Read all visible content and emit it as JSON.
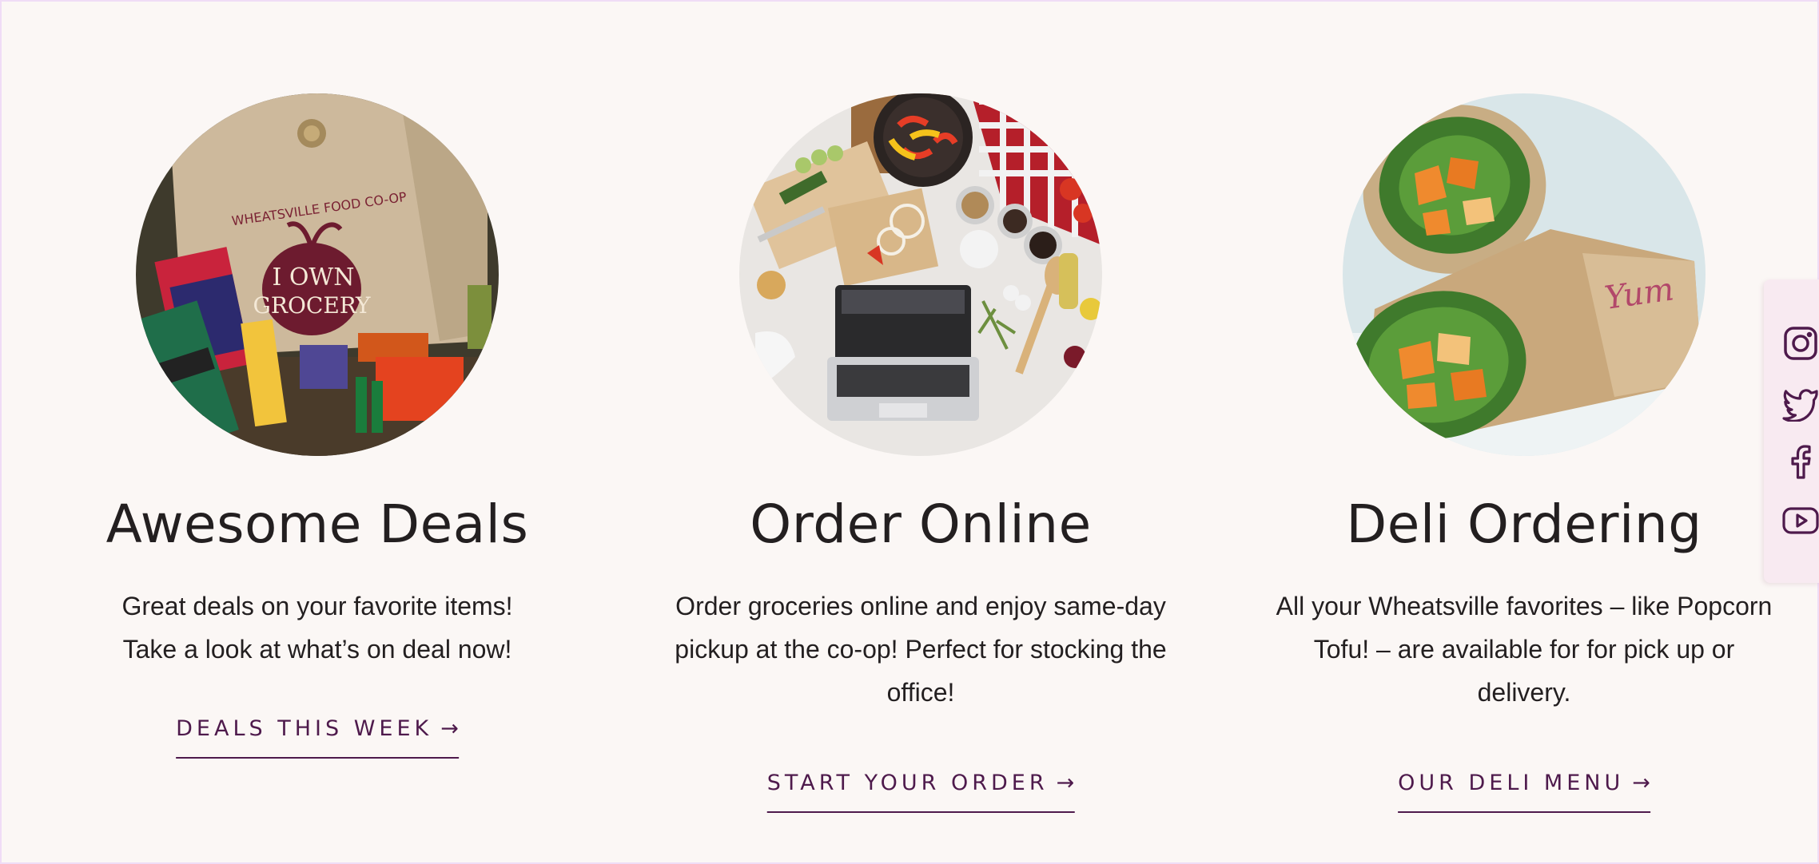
{
  "cards": [
    {
      "title": "Awesome Deals",
      "text_lines": [
        "Great deals on your favorite items!",
        "Take a look at what’s on deal now!"
      ],
      "cta": "DEALS THIS WEEK",
      "arrow": "→",
      "image_icon": "grocery-tote-photo"
    },
    {
      "title": "Order Online",
      "text_lines": [
        "Order groceries online and enjoy same-day",
        "pickup at the co-op! Perfect for stocking the",
        "office!"
      ],
      "cta": "START YOUR ORDER",
      "arrow": "→",
      "image_icon": "laptop-kitchen-photo"
    },
    {
      "title": "Deli Ordering",
      "text_lines": [
        "All your Wheatsville favorites – like Popcorn",
        "Tofu! – are available for for pick up or",
        "delivery."
      ],
      "cta": "OUR DELI MENU",
      "arrow": "→",
      "image_icon": "deli-wrap-photo"
    }
  ],
  "photo_text": {
    "tote_top": "WHEATSVILLE FOOD CO-OP",
    "tote_line1": "I OWN",
    "tote_line2": "GROCERY"
  },
  "social": {
    "icons": [
      "instagram-icon",
      "twitter-icon",
      "facebook-icon",
      "youtube-icon"
    ]
  },
  "colors": {
    "background": "#fbf7f5",
    "heading": "#231f20",
    "accent": "#4e1a4c",
    "social_bg": "#f8eaf1",
    "frame_border": "#f0dcf6"
  }
}
